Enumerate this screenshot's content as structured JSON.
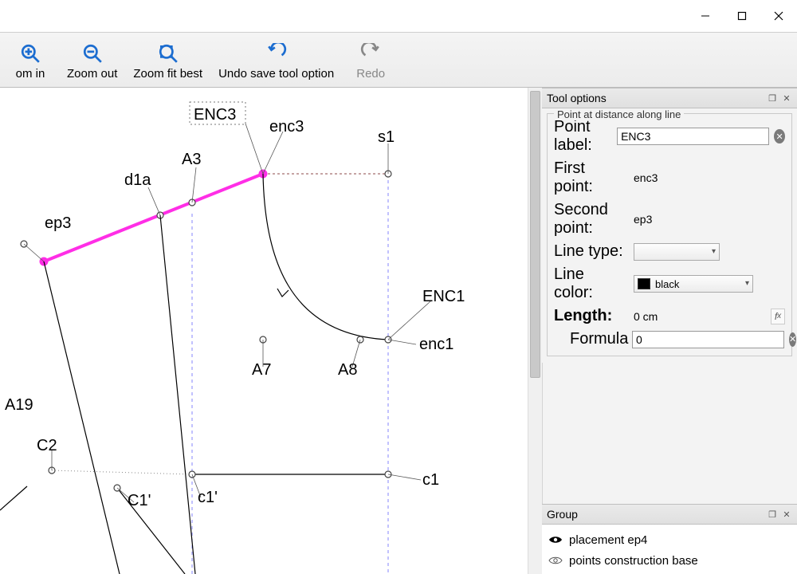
{
  "window": {
    "buttons": {
      "minimize": "minimize",
      "maximize": "maximize",
      "close": "close"
    }
  },
  "toolbar": {
    "zoom_in": "om in",
    "zoom_out": "Zoom out",
    "zoom_fit": "Zoom fit best",
    "undo": "Undo save tool option",
    "redo": "Redo"
  },
  "canvas": {
    "labels": {
      "ENC3": "ENC3",
      "enc3": "enc3",
      "s1": "s1",
      "A3": "A3",
      "d1a": "d1a",
      "ep3": "ep3",
      "A7": "A7",
      "A8": "A8",
      "ENC1": "ENC1",
      "enc1": "enc1",
      "A19": "A19",
      "C2": "C2",
      "C1p": "C1'",
      "c1p": "c1'",
      "c1": "c1"
    }
  },
  "tool_options": {
    "title": "Tool options",
    "legend": "Point at distance along line",
    "point_label_lbl": "Point label:",
    "point_label_val": "ENC3",
    "first_point_lbl": "First point:",
    "first_point_val": "enc3",
    "second_point_lbl": "Second point:",
    "second_point_val": "ep3",
    "line_type_lbl": "Line type:",
    "line_type_val": "",
    "line_color_lbl": "Line color:",
    "line_color_val": "black",
    "length_lbl": "Length:",
    "length_val": "0 cm",
    "formula_lbl": "Formula",
    "formula_val": "0"
  },
  "group": {
    "title": "Group",
    "items": [
      {
        "visible": true,
        "label": "placement ep4"
      },
      {
        "visible": false,
        "label": "points construction base"
      }
    ]
  }
}
